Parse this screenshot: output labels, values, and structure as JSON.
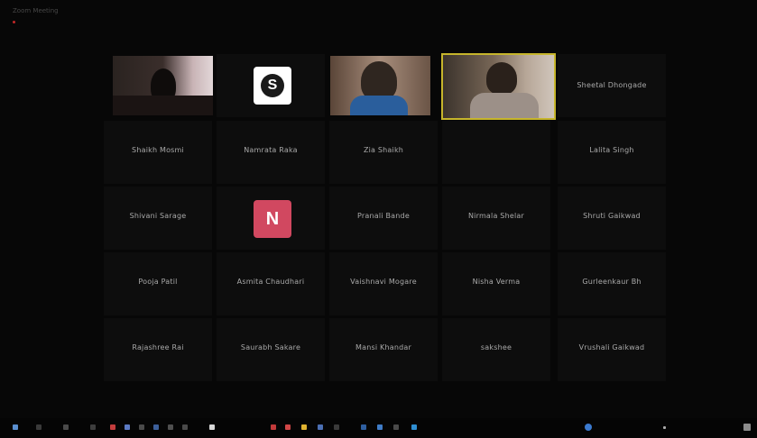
{
  "window": {
    "title": "Zoom Meeting"
  },
  "participants": {
    "video_1": {
      "name": ""
    },
    "s_tile": {
      "name": "",
      "avatar_letter": "S"
    },
    "video_2": {
      "name": ""
    },
    "video_3": {
      "name": ""
    },
    "sheetal": {
      "name": "Sheetal Dhongade"
    },
    "shaikh_mosmi": {
      "name": "Shaikh Mosmi"
    },
    "namrata": {
      "name": "Namrata Raka"
    },
    "zia": {
      "name": "Zia Shaikh"
    },
    "lalita": {
      "name": "Lalita Singh"
    },
    "shivani": {
      "name": "Shivani Sarage"
    },
    "n_tile": {
      "name": "",
      "avatar_letter": "N"
    },
    "pranali": {
      "name": "Pranali Bande"
    },
    "nirmala": {
      "name": "Nirmala Shelar"
    },
    "shruti": {
      "name": "Shruti Gaikwad"
    },
    "pooja": {
      "name": "Pooja Patil"
    },
    "asmita": {
      "name": "Asmita Chaudhari"
    },
    "vaishnavi": {
      "name": "Vaishnavi Mogare"
    },
    "nisha": {
      "name": "Nisha Verma"
    },
    "gurleen": {
      "name": "Gurleenkaur Bh"
    },
    "rajashree": {
      "name": "Rajashree Rai"
    },
    "saurabh": {
      "name": "Saurabh Sakare"
    },
    "mansi": {
      "name": "Mansi Khandar"
    },
    "sakshee": {
      "name": "sakshee"
    },
    "vrushali": {
      "name": "Vrushali Gaikwad"
    }
  },
  "colors": {
    "active_speaker_border": "#c6b52b",
    "s_avatar_bg": "#ffffff",
    "n_avatar_bg": "#d14860"
  },
  "taskbar": {
    "icons": [
      "start-icon",
      "search-icon",
      "task-view-icon",
      "app-icon",
      "app-icon",
      "app-icon",
      "app-icon",
      "chrome-icon",
      "app-icon",
      "app-icon",
      "app-icon",
      "tray-icon",
      "clock"
    ]
  }
}
